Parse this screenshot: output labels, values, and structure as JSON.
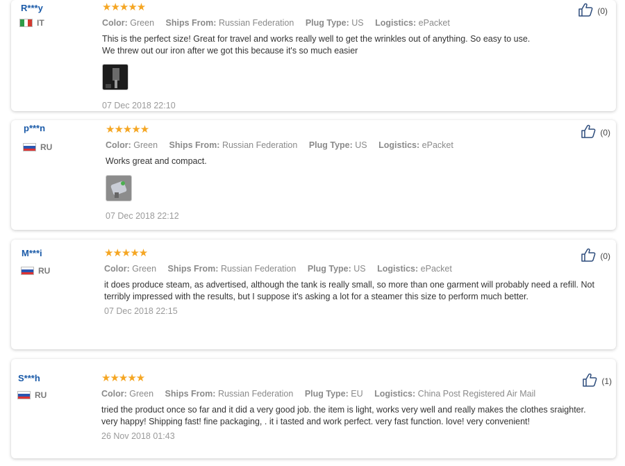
{
  "reviews": [
    {
      "user": "R***y",
      "country": "IT",
      "rating": "★★★★★",
      "attrs": {
        "color_label": "Color:",
        "color": "Green",
        "ships_label": "Ships From:",
        "ships": "Russian Federation",
        "plug_label": "Plug Type:",
        "plug": "US",
        "logistics_label": "Logistics:",
        "logistics": "ePacket"
      },
      "text": "This is the perfect size! Great for travel and works really well to get the wrinkles out of anything. So easy to use. We threw out our iron after we got this because it's so much easier",
      "date": "07 Dec 2018 22:10",
      "likes": "(0)"
    },
    {
      "user": "p***n",
      "country": "RU",
      "rating": "★★★★★",
      "attrs": {
        "color_label": "Color:",
        "color": "Green",
        "ships_label": "Ships From:",
        "ships": "Russian Federation",
        "plug_label": "Plug Type:",
        "plug": "US",
        "logistics_label": "Logistics:",
        "logistics": "ePacket"
      },
      "text": "Works great and compact.",
      "date": "07 Dec 2018 22:12",
      "likes": "(0)"
    },
    {
      "user": "M***i",
      "country": "RU",
      "rating": "★★★★★",
      "attrs": {
        "color_label": "Color:",
        "color": "Green",
        "ships_label": "Ships From:",
        "ships": "Russian Federation",
        "plug_label": "Plug Type:",
        "plug": "US",
        "logistics_label": "Logistics:",
        "logistics": "ePacket"
      },
      "text": "it does produce steam, as advertised, although the tank is really small, so more than one garment will probably need a refill. Not terribly impressed with the results, but I suppose it's asking a lot for a steamer this size to perform much better.",
      "date": "07 Dec 2018 22:15",
      "likes": "(0)"
    },
    {
      "user": "S***h",
      "country": "RU",
      "rating": "★★★★★",
      "attrs": {
        "color_label": "Color:",
        "color": "Green",
        "ships_label": "Ships From:",
        "ships": "Russian Federation",
        "plug_label": "Plug Type:",
        "plug": "EU",
        "logistics_label": "Logistics:",
        "logistics": "China Post Registered Air Mail"
      },
      "text": "tried the product once so far and it did a very good job. the item is light, works very well and really makes the clothes sraighter. very happy! Shipping fast! fine packaging, . it i tasted and work perfect. very fast function. love! very convenient!",
      "date": "26 Nov 2018 01:43",
      "likes": "(1)"
    }
  ],
  "colors": {
    "username": "#1a5aa8",
    "stars": "#f5a623",
    "muted": "#8a8a8a"
  },
  "icons": {
    "like": "thumbs-up-icon",
    "rating": "star-icon"
  }
}
